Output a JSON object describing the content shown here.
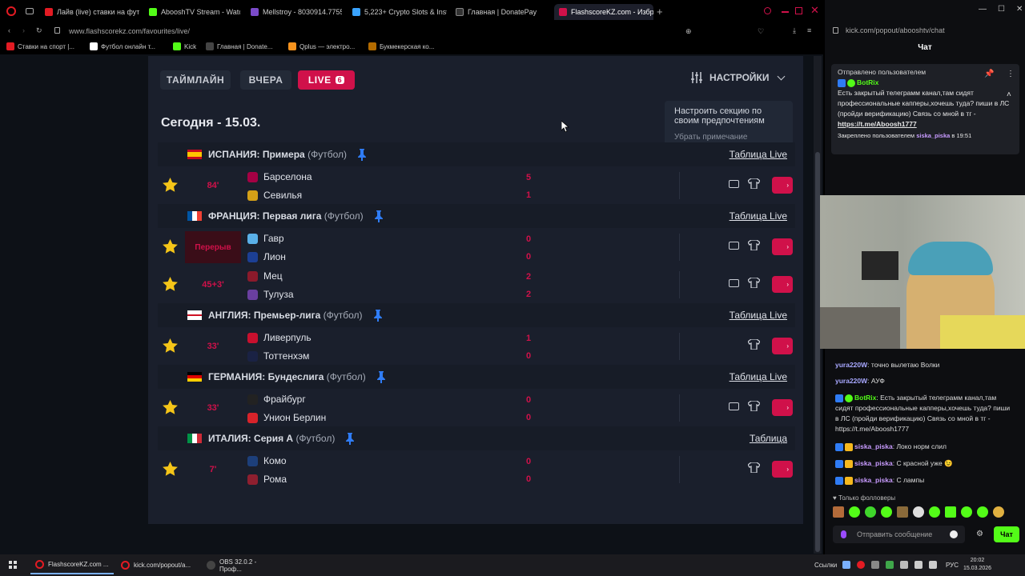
{
  "tabs": [
    {
      "label": "Лайв (live) ставки на футб",
      "color": "#e31b23"
    },
    {
      "label": "AbooshTV Stream - Watch",
      "color": "#53fc18"
    },
    {
      "label": "Mellstroy - 8030914.7755",
      "color": "#7b4bc9"
    },
    {
      "label": "5,223+ Crypto Slots & Insta",
      "color": "#3aa3ff"
    },
    {
      "label": "Главная | DonatePay",
      "color": "#222"
    },
    {
      "label": "FlashscoreKZ.com - Избр",
      "color": "#d0114a"
    }
  ],
  "address": {
    "url": "www.flashscorekz.com/favourites/live/"
  },
  "bookmarks": [
    {
      "label": "Ставки на спорт |...",
      "color": "#e31b23"
    },
    {
      "label": "Футбол онлайн т...",
      "color": "#fff"
    },
    {
      "label": "Kick",
      "color": "#53fc18"
    },
    {
      "label": "Главная | Donate...",
      "color": "#222"
    },
    {
      "label": "Qplus — электро...",
      "color": "#f7931e"
    },
    {
      "label": "Букмекерская ко...",
      "color": "#b36b00"
    }
  ],
  "nav": {
    "timeline": "ТАЙМЛАЙН",
    "yesterday": "ВЧЕРА",
    "live": "LIVE",
    "live_count": "6",
    "settings": "НАСТРОЙКИ"
  },
  "date_title": "Сегодня - 15.03.",
  "tooltip": {
    "text": "Настроить секцию по своим предпочтениям",
    "dismiss": "Убрать примечание"
  },
  "leagues": [
    {
      "country": "ИСПАНИЯ:",
      "name": "Примера",
      "sport": "(Футбол)",
      "link": "Таблица Live",
      "flag": "es",
      "matches": [
        {
          "time": "84'",
          "home": "Барселона",
          "away": "Севилья",
          "hs": "5",
          "as": "1",
          "pause": false
        }
      ]
    },
    {
      "country": "ФРАНЦИЯ:",
      "name": "Первая лига",
      "sport": "(Футбол)",
      "link": "Таблица Live",
      "flag": "fr",
      "matches": [
        {
          "time": "Перерыв",
          "home": "Гавр",
          "away": "Лион",
          "hs": "0",
          "as": "0",
          "pause": true
        },
        {
          "time": "45+3'",
          "home": "Мец",
          "away": "Тулуза",
          "hs": "2",
          "as": "2",
          "pause": false
        }
      ]
    },
    {
      "country": "АНГЛИЯ:",
      "name": "Премьер-лига",
      "sport": "(Футбол)",
      "link": "Таблица Live",
      "flag": "en",
      "matches": [
        {
          "time": "33'",
          "home": "Ливерпуль",
          "away": "Тоттенхэм",
          "hs": "1",
          "as": "0",
          "pause": false
        }
      ]
    },
    {
      "country": "ГЕРМАНИЯ:",
      "name": "Бундеслига",
      "sport": "(Футбол)",
      "link": "Таблица Live",
      "flag": "de",
      "matches": [
        {
          "time": "33'",
          "home": "Фрайбург",
          "away": "Унион Берлин",
          "hs": "0",
          "as": "0",
          "pause": false
        }
      ]
    },
    {
      "country": "ИТАЛИЯ:",
      "name": "Серия А",
      "sport": "(Футбол)",
      "link": "Таблица",
      "flag": "it",
      "matches": [
        {
          "time": "7'",
          "home": "Комо",
          "away": "Рома",
          "hs": "0",
          "as": "0",
          "pause": false
        }
      ]
    }
  ],
  "chat": {
    "url": "kick.com/popout/abooshtv/chat",
    "title": "Чат",
    "pinned_by": "Отправлено пользователем",
    "bot": "BotRix",
    "pinned_text": "Есть закрытый телеграмм канал,там сидят профессиональные капперы,хочешь туда? пиши в ЛС (пройди верификацию) Связь со мной в тг -",
    "pinned_link": "https://t.me/Aboosh1777",
    "pinned_footer": "Закреплено пользователем",
    "pinned_user": "siska_piska",
    "pinned_time": "в 19:51",
    "messages": [
      {
        "nick": "yura220W",
        "text": "точно вылетаю Волки",
        "color": "#a8a8ff"
      },
      {
        "nick": "yura220W",
        "text": "АУФ",
        "color": "#a8a8ff"
      },
      {
        "nick": "BotRix",
        "text": "Есть закрытый телеграмм канал,там сидят профессиональные капперы,хочешь туда? пиши в ЛС (пройди верификацию) Связь со мной в тг - https://t.me/Aboosh1777",
        "color": "#53fc18"
      },
      {
        "nick": "siska_piska",
        "text": "Локо норм слил",
        "color": "#c89bff"
      },
      {
        "nick": "siska_piska",
        "text": "С красной уже 😉",
        "color": "#c89bff"
      },
      {
        "nick": "siska_piska",
        "text": "С лампы",
        "color": "#c89bff"
      }
    ],
    "followers_only": "Только фолловеры",
    "input_placeholder": "Отправить сообщение",
    "send": "Чат"
  },
  "taskbar": {
    "items": [
      "FlashscoreKZ.com ...",
      "kick.com/popout/a...",
      "OBS 32.0.2 - Проф..."
    ],
    "links": "Ссылки",
    "lang": "РУС",
    "time": "20:02",
    "date": "15.03.2026"
  }
}
